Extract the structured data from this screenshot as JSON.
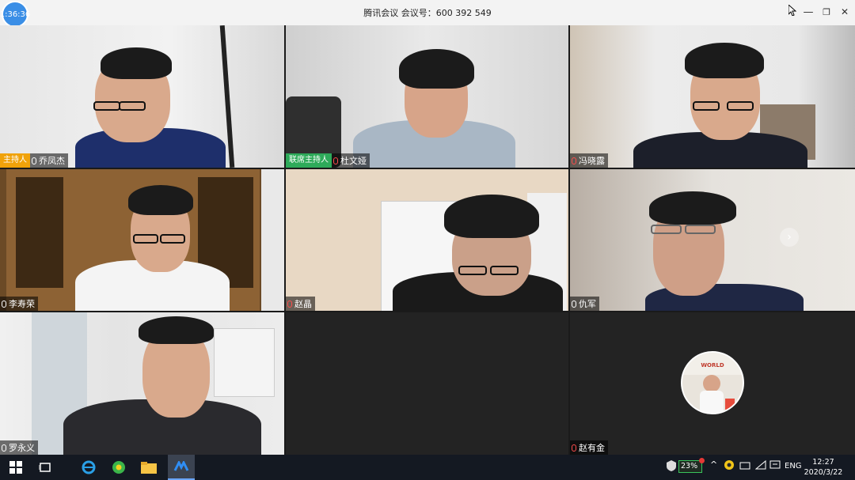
{
  "window": {
    "title": "腾讯会议 会议号：600 392 549",
    "timer": "1:36:36",
    "btn_min": "—",
    "btn_restore": "❐",
    "btn_close": "✕"
  },
  "participants": [
    {
      "name": "乔凤杰",
      "badge": "主持人",
      "badge_type": "host",
      "mic": "on"
    },
    {
      "name": "杜文娅",
      "badge": "联席主持人",
      "badge_type": "cohost",
      "mic": "muted"
    },
    {
      "name": "冯晓露",
      "badge": "",
      "mic": "muted"
    },
    {
      "name": "李寿荣",
      "badge": "",
      "mic": "on"
    },
    {
      "name": "赵晶",
      "badge": "",
      "mic": "muted"
    },
    {
      "name": "仇军",
      "badge": "",
      "mic": "on"
    },
    {
      "name": "罗永义",
      "badge": "",
      "mic": "on"
    },
    {
      "name": "赵有金",
      "badge": "",
      "mic": "muted"
    }
  ],
  "avatar_text": "WORLD",
  "next_page": "›",
  "taskbar": {
    "battery": "23%",
    "lang": "ENG",
    "time": "12:27",
    "date": "2020/3/22"
  },
  "colors": {
    "host_badge": "#f0a20a",
    "cohost_badge": "#2eaa5a",
    "timer": "#3a8ee6"
  }
}
